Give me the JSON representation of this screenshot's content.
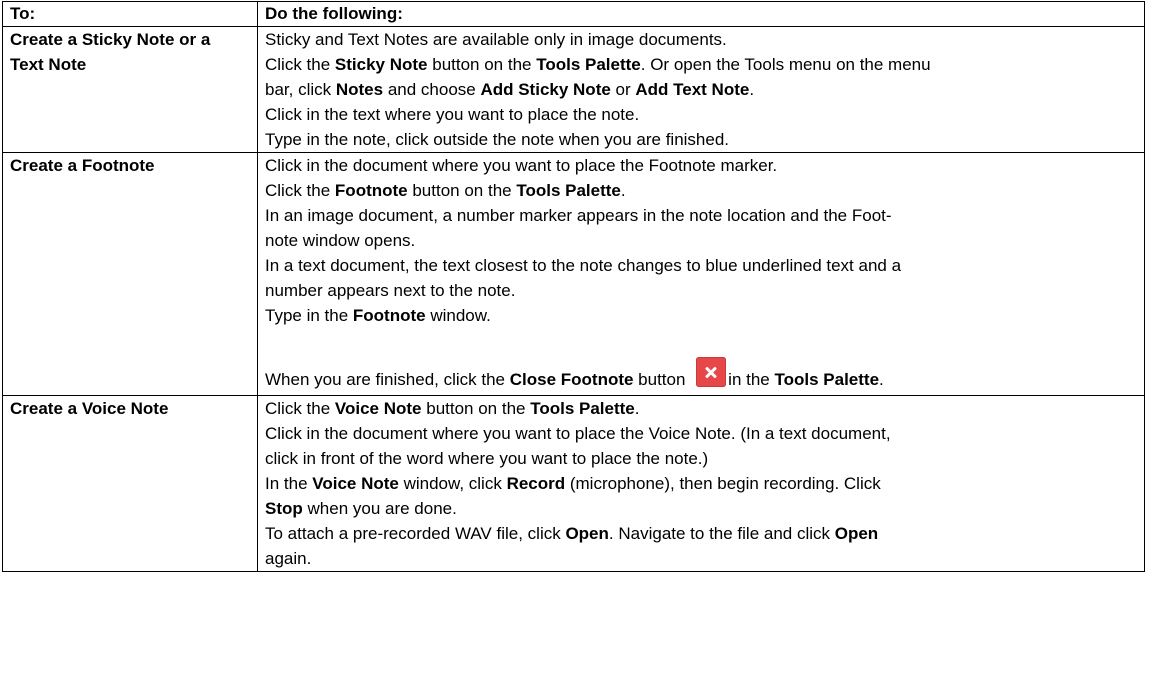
{
  "table": {
    "header": {
      "col1": "To:",
      "col2": "Do the following:"
    },
    "rows": [
      {
        "task": "Create a Sticky Note or a Text Note",
        "line1": "Sticky and Text Notes are available only in image documents.",
        "line2": {
          "p1": "Click the ",
          "b1": "Sticky Note",
          "p2": " button on the ",
          "b2": "Tools Palette",
          "p3": ". Or open the Tools menu on the menu bar, click ",
          "b3": "Notes",
          "p4": " and choose ",
          "b4": "Add Sticky Note",
          "p5": " or ",
          "b5": "Add Text Note",
          "p6": "."
        },
        "line3": "Click in the text where you want to place the note.",
        "line4": "Type in the note, click outside the note when you are finished."
      },
      {
        "task": "Create a Footnote",
        "line1": "Click in the document where you want to place the Footnote marker.",
        "line2": {
          "p1": "Click the ",
          "b1": "Footnote",
          "p2": " button on the ",
          "b2": "Tools Palette",
          "p3": "."
        },
        "line3": "In an image document, a number marker appears in the note location and the Foot-",
        "line3b": "note window opens.",
        "line4": "In a text document, the text closest to the note changes to blue underlined text and a",
        "line4b": "number appears next to the note.",
        "line5": {
          "p1": "Type in the ",
          "b1": "Footnote",
          "p2": " window."
        },
        "line6": {
          "p1": "When you are finished, click the ",
          "b1": "Close Footnote",
          "p2": " button ",
          "icon": "close-icon",
          "p3": "in the ",
          "b2": "Tools Palette",
          "p4": "."
        }
      },
      {
        "task": "Create a Voice Note",
        "line1": {
          "p1": "Click the ",
          "b1": "Voice Note",
          "p2": " button on the ",
          "b2": "Tools Palette",
          "p3": "."
        },
        "line2": "Click in the document where you want to place the Voice Note. (In a text document,",
        "line2b": "click in front of the word where you want to place the note.)",
        "line3": {
          "p1": "In the ",
          "b1": "Voice Note",
          "p2": " window, click ",
          "b2": "Record",
          "p3": " (microphone), then begin recording. Click"
        },
        "line3b": {
          "b1": "Stop",
          "p1": " when you are done."
        },
        "line4": {
          "p1": "To attach a pre-recorded WAV file, click ",
          "b1": "Open",
          "p2": ". Navigate to the file and click ",
          "b2": "Open"
        },
        "line4b": "again."
      }
    ]
  },
  "colors": {
    "close_icon": "#e8474a",
    "border": "#000000"
  }
}
